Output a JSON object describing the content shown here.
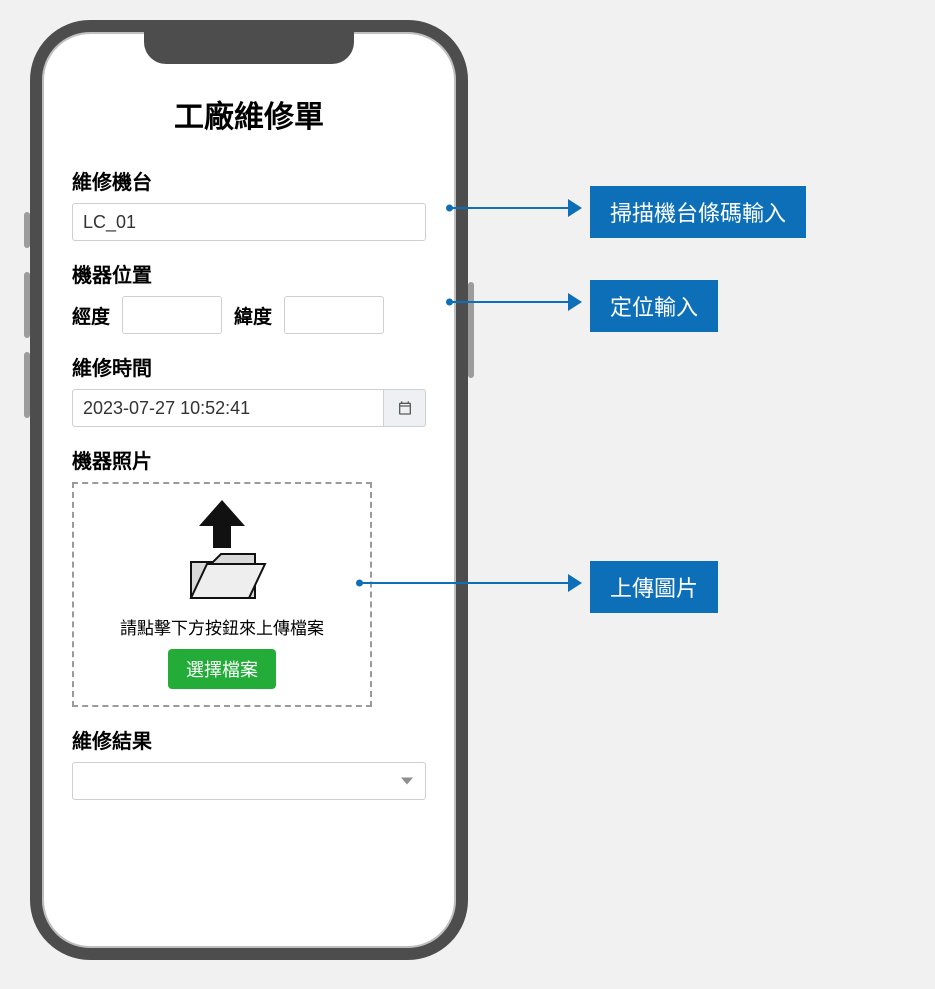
{
  "title": "工廠維修單",
  "form": {
    "machine_label": "維修機台",
    "machine_value": "LC_01",
    "location_label": "機器位置",
    "lng_label": "經度",
    "lat_label": "緯度",
    "time_label": "維修時間",
    "time_value": "2023-07-27 10:52:41",
    "photo_label": "機器照片",
    "upload_hint": "請點擊下方按鈕來上傳檔案",
    "choose_file_btn": "選擇檔案",
    "result_label": "維修結果"
  },
  "callouts": {
    "scan_barcode": "掃描機台條碼輸入",
    "geolocate": "定位輸入",
    "upload_image": "上傳圖片"
  }
}
